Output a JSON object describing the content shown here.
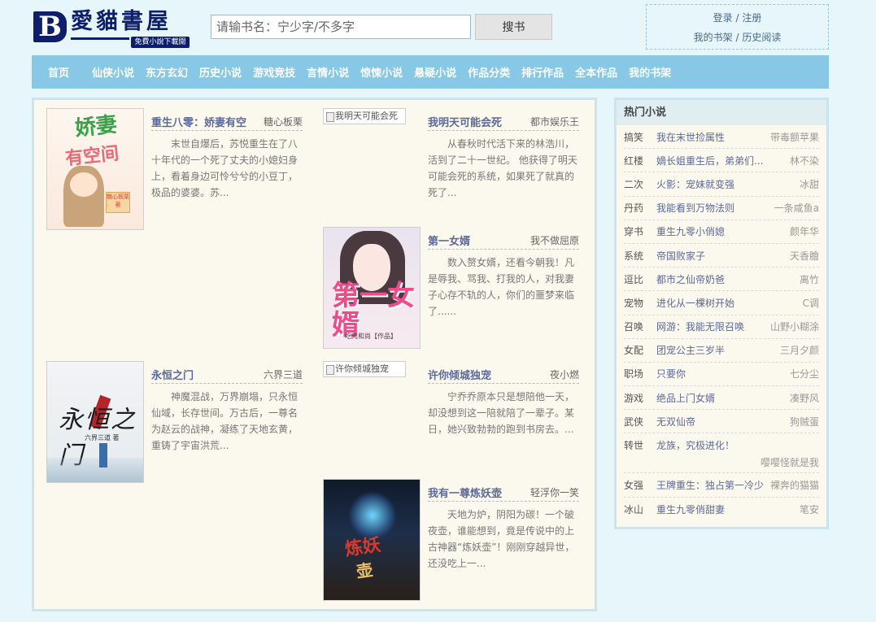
{
  "logo": {
    "letter": "B",
    "title": "愛貓書屋",
    "subtitle": "免費小說下載閱"
  },
  "search": {
    "placeholder": "请输书名：宁少字/不多字",
    "button_label": "搜书"
  },
  "user": {
    "login": "登录",
    "register": "注册",
    "sep": " / ",
    "bookshelf": "我的书架",
    "history": "历史阅读"
  },
  "nav": [
    "首页",
    "仙侠小说",
    "东方玄幻",
    "历史小说",
    "游戏竞技",
    "言情小说",
    "惊悚小说",
    "悬疑小说",
    "作品分类",
    "排行作品",
    "全本作品",
    "我的书架"
  ],
  "books": [
    {
      "title": "重生八零：娇妻有空",
      "author": "糖心板栗",
      "desc": "末世自爆后，苏悦重生在了八十年代的一个死了丈夫的小媳妇身上，看着身边可怜兮兮的小豆丁，极品的婆婆。苏...",
      "cover_alt": "",
      "cover_text": "娇妻",
      "cover_text2": "有空间",
      "cover_sign": "糖心板栗著"
    },
    {
      "title": "我明天可能会死",
      "author": "都市娱乐王",
      "desc": "从春秋时代活下来的林浩川，活到了二十一世纪。 他获得了明天可能会死的系统，如果死了就真的死了...",
      "cover_alt": "我明天可能会死"
    },
    {
      "title": "第一女婿",
      "author": "我不做屈原",
      "desc": "数入赘女婿，还看今朝我！凡是辱我、骂我、打我的人，对我妻子心存不轨的人，你们的噩梦来临了......",
      "cover_alt": "",
      "cover_text": "第一女婿",
      "cover_sign": "吃肉和尚【作品】"
    },
    {
      "title": "永恒之门",
      "author": "六界三道",
      "desc": "神魔混战，万界崩塌，只永恒仙域，长存世间。万古后，一尊名为赵云的战神，凝练了天地玄黄，重铸了宇宙洪荒...",
      "cover_alt": "",
      "cover_text": "永恒之门",
      "cover_sign": "六界三道 著"
    },
    {
      "title": "许你倾城独宠",
      "author": "夜小燃",
      "desc": "宁乔乔原本只是想陪他一天，却没想到这一陪就陪了一辈子。某日，她兴致勃勃的跑到书房去。...",
      "cover_alt": "许你倾城独宠"
    },
    {
      "title": "我有一尊炼妖壶",
      "author": "轻浮你一笑",
      "desc": "天地为炉，阴阳为碳！一个破夜壶，谁能想到，竟是传说中的上古神器“炼妖壶”！刚刚穿越异世，还没吃上一...",
      "cover_alt": "",
      "cover_text": "炼妖",
      "cover_text2": "壶"
    }
  ],
  "sidebar": {
    "title": "热门小说",
    "items": [
      {
        "cat": "搞笑",
        "title": "我在末世捡属性",
        "author": "带毒额苹果"
      },
      {
        "cat": "红楼",
        "title": "嫡长姐重生后，弟弟们...",
        "author": "林不染"
      },
      {
        "cat": "二次",
        "title": "火影：宠妹就变强",
        "author": "冰甜"
      },
      {
        "cat": "丹药",
        "title": "我能看到万物法则",
        "author": "一条咸鱼a"
      },
      {
        "cat": "穿书",
        "title": "重生九零小俏媳",
        "author": "颜年华"
      },
      {
        "cat": "系统",
        "title": "帝国败家子",
        "author": "天香膾"
      },
      {
        "cat": "逗比",
        "title": "都市之仙帝奶爸",
        "author": "离竹"
      },
      {
        "cat": "宠物",
        "title": "进化从一棵树开始",
        "author": "C调"
      },
      {
        "cat": "召唤",
        "title": "网游：我能无限召唤",
        "author": "山野小糊涂"
      },
      {
        "cat": "女配",
        "title": "团宠公主三岁半",
        "author": "三月夕颜"
      },
      {
        "cat": "职场",
        "title": "只要你",
        "author": "七分尘"
      },
      {
        "cat": "游戏",
        "title": "绝品上门女婿",
        "author": "凑野风"
      },
      {
        "cat": "武侠",
        "title": "无双仙帝",
        "author": "狗贼蛋"
      },
      {
        "cat": "转世",
        "title": "龙族，究极进化！",
        "author": "嘤嘤怪就是我"
      },
      {
        "cat": "女强",
        "title": "王牌重生：独占第一冷少",
        "author": "裸奔的猫猫"
      },
      {
        "cat": "冰山",
        "title": "重生九零俏甜妻",
        "author": "笔安"
      }
    ]
  }
}
